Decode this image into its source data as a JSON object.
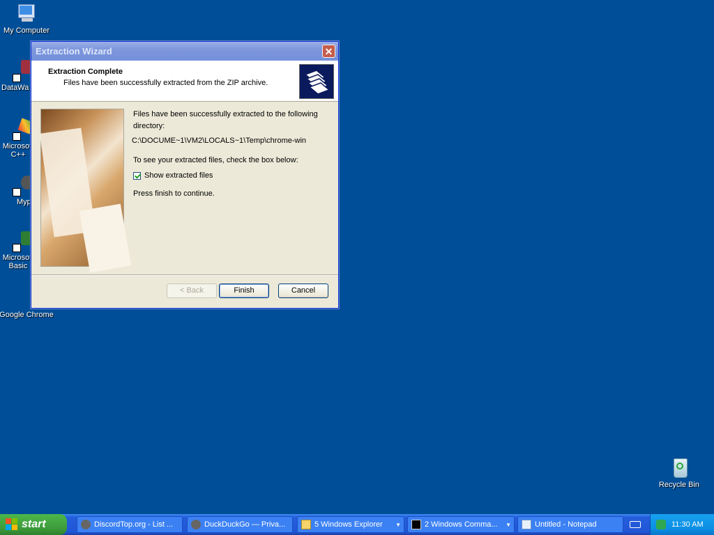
{
  "desktop": {
    "icons": [
      {
        "label": "My Computer",
        "icon": "computer-icon"
      },
      {
        "label": "DataWa",
        "icon": "shortcut-icon"
      },
      {
        "label": "Microsoft C++",
        "icon": "shortcut-icon"
      },
      {
        "label": "Myp",
        "icon": "shortcut-icon"
      },
      {
        "label": "Microsoft Basic",
        "icon": "shortcut-icon"
      },
      {
        "label": "Google Chrome",
        "icon": "chrome-icon"
      },
      {
        "label": "Recycle Bin",
        "icon": "recycle-bin-icon"
      }
    ]
  },
  "wizard": {
    "title": "Extraction Wizard",
    "header_title": "Extraction Complete",
    "header_subtitle": "Files have been successfully extracted from the ZIP archive.",
    "body_line1": "Files have been successfully extracted to the following directory:",
    "path": "C:\\DOCUME~1\\VM2\\LOCALS~1\\Temp\\chrome-win",
    "body_line2": "To see your extracted files, check the box below:",
    "checkbox_label": "Show extracted files",
    "checkbox_checked": true,
    "body_line3": "Press finish to continue.",
    "buttons": {
      "back": "< Back",
      "finish": "Finish",
      "cancel": "Cancel"
    },
    "close_glyph": "✕"
  },
  "taskbar": {
    "start_label": "start",
    "items": [
      {
        "label": "DiscordTop.org - List ..."
      },
      {
        "label": "DuckDuckGo — Priva..."
      },
      {
        "label": "5 Windows Explorer"
      },
      {
        "label": "2 Windows Comma..."
      },
      {
        "label": "Untitled - Notepad"
      }
    ],
    "clock": "11:30 AM"
  },
  "colors": {
    "desktop": "#004e98",
    "taskbar": "#245edb",
    "start": "#3c9a3a"
  }
}
